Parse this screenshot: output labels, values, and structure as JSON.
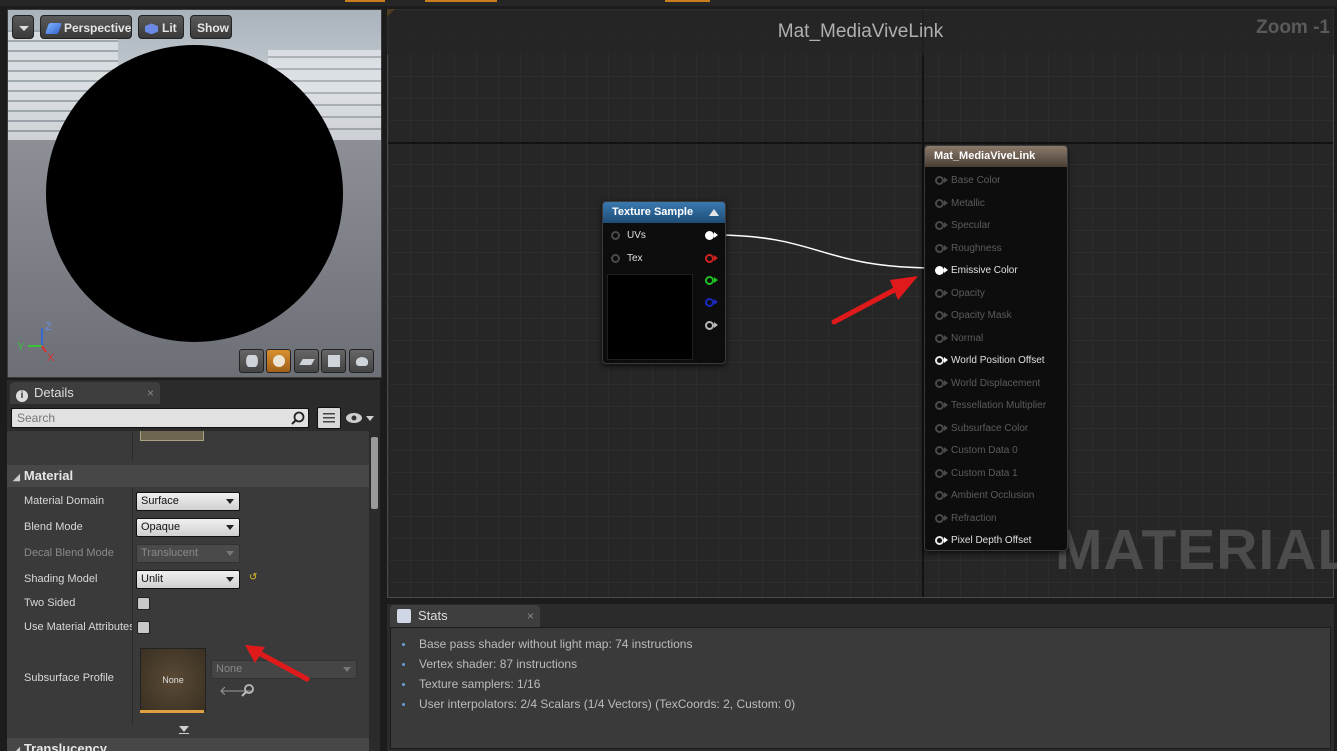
{
  "viewport": {
    "toolbar": {
      "perspective": "Perspective",
      "lit": "Lit",
      "show": "Show"
    },
    "axis": {
      "x": "X",
      "y": "Y",
      "z": "Z"
    },
    "mode_buttons": [
      "cylinder-icon",
      "sphere-icon",
      "plane-icon",
      "cube-icon",
      "teapot-icon"
    ]
  },
  "details": {
    "tab_label": "Details",
    "search_placeholder": "Search",
    "section_material": "Material",
    "section_translucency": "Translucency",
    "properties": [
      {
        "label": "Material Domain",
        "value": "Surface",
        "enabled": true
      },
      {
        "label": "Blend Mode",
        "value": "Opaque",
        "enabled": true
      },
      {
        "label": "Decal Blend Mode",
        "value": "Translucent",
        "enabled": false
      },
      {
        "label": "Shading Model",
        "value": "Unlit",
        "enabled": true
      }
    ],
    "two_sided": {
      "label": "Two Sided",
      "checked": false
    },
    "use_material_attributes": {
      "label": "Use Material Attributes",
      "checked": false
    },
    "subsurface": {
      "label": "Subsurface Profile",
      "thumb_text": "None",
      "value": "None"
    }
  },
  "graph": {
    "title": "Mat_MediaViveLink",
    "zoom": "Zoom -1",
    "watermark": "MATERIAL",
    "texture_node": {
      "title": "Texture Sample",
      "inputs": [
        "UVs",
        "Tex"
      ],
      "output_colors": [
        "#ffffff",
        "#d02020",
        "#20c020",
        "#1a2ac0",
        "#b8b8b8"
      ],
      "header_color": "#2a5a86"
    },
    "result_node": {
      "title": "Mat_MediaViveLink",
      "header_color": "#6a5a4a",
      "inputs": [
        {
          "label": "Base Color",
          "active": false
        },
        {
          "label": "Metallic",
          "active": false
        },
        {
          "label": "Specular",
          "active": false
        },
        {
          "label": "Roughness",
          "active": false
        },
        {
          "label": "Emissive Color",
          "active": true
        },
        {
          "label": "Opacity",
          "active": false
        },
        {
          "label": "Opacity Mask",
          "active": false
        },
        {
          "label": "Normal",
          "active": false
        },
        {
          "label": "World Position Offset",
          "active": true
        },
        {
          "label": "World Displacement",
          "active": false
        },
        {
          "label": "Tessellation Multiplier",
          "active": false
        },
        {
          "label": "Subsurface Color",
          "active": false
        },
        {
          "label": "Custom Data 0",
          "active": false
        },
        {
          "label": "Custom Data 1",
          "active": false
        },
        {
          "label": "Ambient Occlusion",
          "active": false
        },
        {
          "label": "Refraction",
          "active": false
        },
        {
          "label": "Pixel Depth Offset",
          "active": true
        }
      ]
    }
  },
  "stats": {
    "tab_label": "Stats",
    "lines": [
      "Base pass shader without light map: 74 instructions",
      "Vertex shader: 87 instructions",
      "Texture samplers: 1/16",
      "User interpolators: 2/4 Scalars (1/4 Vectors) (TexCoords: 2, Custom: 0)"
    ]
  },
  "colors": {
    "accent": "#c87d1e",
    "annotation_arrow": "#e01a1a"
  }
}
